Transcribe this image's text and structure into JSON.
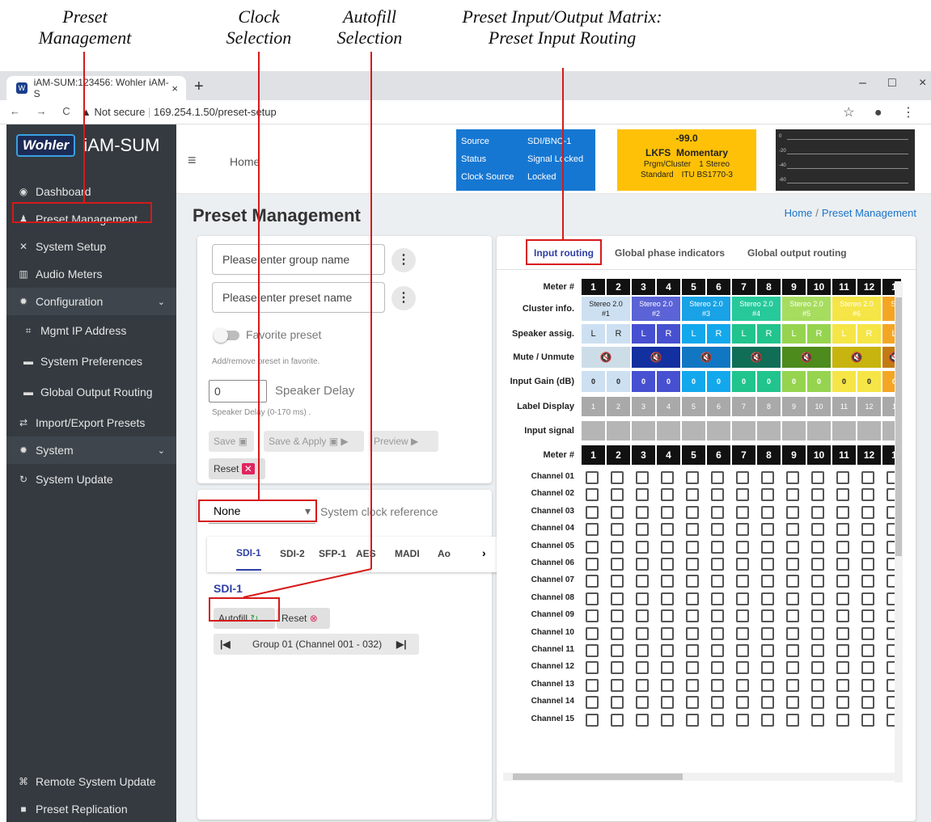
{
  "annotations": {
    "preset_mgmt": [
      "Preset",
      "Management"
    ],
    "clock_sel": [
      "Clock",
      "Selection"
    ],
    "autofill_sel": [
      "Autofill",
      "Selection"
    ],
    "matrix": [
      "Preset Input/Output Matrix:",
      "Preset Input Routing"
    ]
  },
  "browser": {
    "tab_title": "iAM-SUM:123456: Wohler iAM-S",
    "tab_close": "×",
    "new_tab": "+",
    "win_min": "–",
    "win_max": "□",
    "win_close": "×",
    "nav_icons": "← → C",
    "security": "▲ Not secure",
    "url": "169.254.1.50/preset-setup",
    "right_icons": "☆ ● ⋮"
  },
  "sidebar": {
    "logo_box": "Wohler",
    "logo_text": "iAM-SUM",
    "items": [
      {
        "icon": "◉",
        "label": "Dashboard"
      },
      {
        "icon": "♟",
        "label": "Preset Management"
      },
      {
        "icon": "✕",
        "label": "System Setup"
      },
      {
        "icon": "▥",
        "label": "Audio Meters"
      },
      {
        "icon": "✹",
        "label": "Configuration",
        "chev": "⌄"
      },
      {
        "icon": "⌗",
        "label": "Mgmt IP Address"
      },
      {
        "icon": "▬",
        "label": "System Preferences"
      },
      {
        "icon": "▬",
        "label": "Global Output Routing"
      },
      {
        "icon": "⇄",
        "label": "Import/Export Presets"
      },
      {
        "icon": "✹",
        "label": "System",
        "chev": "⌄"
      },
      {
        "icon": "↻",
        "label": "System Update"
      },
      {
        "icon": "⌘",
        "label": "Remote System Update"
      },
      {
        "icon": "■",
        "label": "Preset Replication"
      }
    ]
  },
  "header": {
    "menu": "≡",
    "home": "Home",
    "source": {
      "k1": "Source",
      "v1": "SDI/BNC-1",
      "k2": "Status",
      "v2": "Signal Locked",
      "k3": "Clock Source",
      "v3": "Locked"
    },
    "lkfs": {
      "value": "-99.0",
      "l1": "LKFS",
      "l2": "Momentary",
      "k1": "Prgm/Cluster",
      "v1": "1 Stereo",
      "k2": "Standard",
      "v2": "ITU BS1770-3"
    },
    "meter_labels": [
      "0",
      "-20",
      "-40",
      "-60"
    ]
  },
  "page": {
    "title": "Preset Management",
    "crumb_home": "Home",
    "crumb_sep": "/",
    "crumb_current": "Preset Management"
  },
  "preset_form": {
    "group_placeholder": "Please enter group name",
    "preset_placeholder": "Please enter preset name",
    "more": "⋮",
    "favorite": "Favorite preset",
    "favorite_hint": "Add/remove preset in favorite.",
    "delay_value": "0",
    "delay_label": "Speaker Delay",
    "delay_hint": "Speaker Delay (0-170 ms) .",
    "save": "Save",
    "save_apply": "Save & Apply",
    "preview": "Preview",
    "reset": "Reset"
  },
  "clock": {
    "selected": "None",
    "caret": "▾",
    "label": "System clock reference"
  },
  "source_tabs": [
    "SDI-1",
    "SDI-2",
    "SFP-1",
    "AES",
    "MADI",
    "Ao"
  ],
  "source_more": "›",
  "source_section": {
    "title": "SDI-1",
    "autofill": "Autofill",
    "reset": "Reset",
    "first": "|◀",
    "group": "Group 01 (Channel 001 - 032)",
    "last": "▶|"
  },
  "matrix_tabs": [
    "Input routing",
    "Global phase indicators",
    "Global output routing"
  ],
  "matrix": {
    "row_labels": [
      "Meter #",
      "Cluster info.",
      "Speaker assig.",
      "Mute / Unmute",
      "Input Gain (dB)",
      "Label Display",
      "Input signal",
      "Meter #"
    ],
    "meters": [
      "1",
      "2",
      "3",
      "4",
      "5",
      "6",
      "7",
      "8",
      "9",
      "10",
      "11",
      "12",
      "1"
    ],
    "clusters": [
      {
        "name": "Stereo 2.0",
        "num": "#1",
        "color": "#cde0f2"
      },
      {
        "name": "Stereo 2.0",
        "num": "#2",
        "color": "#5b63d6"
      },
      {
        "name": "Stereo 2.0",
        "num": "#3",
        "color": "#19a2e6"
      },
      {
        "name": "Stereo 2.0",
        "num": "#4",
        "color": "#27c99a"
      },
      {
        "name": "Stereo 2.0",
        "num": "#5",
        "color": "#a7dd5e"
      },
      {
        "name": "Stereo 2.0",
        "num": "#6",
        "color": "#f5e546"
      },
      {
        "name": "St",
        "num": "",
        "color": "#f4a623"
      }
    ],
    "speakers": [
      "L",
      "R",
      "L",
      "R",
      "L",
      "R",
      "L",
      "R",
      "L",
      "R",
      "L",
      "R",
      "L"
    ],
    "mute_icon": "🔇",
    "mute_colors": [
      "#ccdde8",
      "#1330a0",
      "#1277c2",
      "#106e56",
      "#4d8b1c",
      "#c8b40f",
      "#c47a10"
    ],
    "gains": [
      "0",
      "0",
      "0",
      "0",
      "0",
      "0",
      "0",
      "0",
      "0",
      "0",
      "0",
      "0",
      "0"
    ],
    "gain_colors": [
      "#cde0f2",
      "#cde0f2",
      "#4750d0",
      "#4750d0",
      "#13a8ec",
      "#13a8ec",
      "#21c48d",
      "#21c48d",
      "#96d44f",
      "#96d44f",
      "#f5e546",
      "#f5e546",
      "#f4a623"
    ],
    "labels": [
      "1",
      "2",
      "3",
      "4",
      "5",
      "6",
      "7",
      "8",
      "9",
      "10",
      "11",
      "12",
      "1"
    ],
    "channels": [
      "Channel 01",
      "Channel 02",
      "Channel 03",
      "Channel 04",
      "Channel 05",
      "Channel 06",
      "Channel 07",
      "Channel 08",
      "Channel 09",
      "Channel 10",
      "Channel 11",
      "Channel 12",
      "Channel 13",
      "Channel 14",
      "Channel 15"
    ]
  }
}
